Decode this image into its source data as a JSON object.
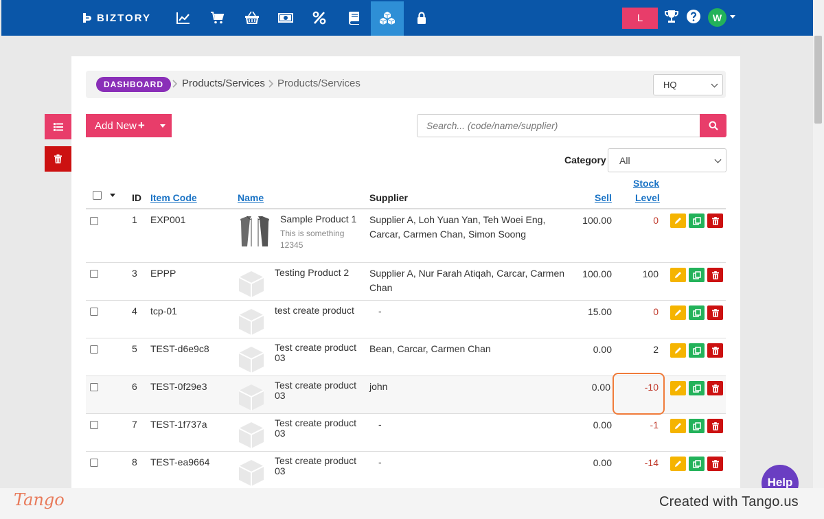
{
  "app": {
    "brand": "BIZTORY",
    "user_badge": "L",
    "avatar_initial": "W"
  },
  "nav_icons": [
    "chart-line-icon",
    "cart-icon",
    "basket-icon",
    "money-icon",
    "percent-icon",
    "book-icon",
    "cubes-icon",
    "lock-icon"
  ],
  "breadcrumb": {
    "root": "DASHBOARD",
    "items": [
      "Products/Services",
      "Products/Services"
    ]
  },
  "branch_select": {
    "value": "HQ"
  },
  "toolbar": {
    "add_new_label": "Add New",
    "search_placeholder": "Search... (code/name/supplier)"
  },
  "category": {
    "label": "Category",
    "value": "All"
  },
  "table": {
    "columns": {
      "id": "ID",
      "item_code": "Item Code",
      "name": "Name",
      "supplier": "Supplier",
      "sell": "Sell",
      "stock_1": "Stock",
      "stock_2": "Level"
    },
    "rows": [
      {
        "id": "1",
        "code": "EXP001",
        "name": "Sample Product 1",
        "desc_1": "This is something",
        "desc_2": "12345",
        "supplier_1": "Supplier A, Loh Yuan Yan, Teh Woei Eng,",
        "supplier_2": "Carcar, Carmen Chan, Simon Soong",
        "sell": "100.00",
        "stock": "0",
        "image": "shirt"
      },
      {
        "id": "3",
        "code": "EPPP",
        "name_1": "Testing Product 2",
        "supplier_1": "Supplier A, Nur Farah Atiqah, Carcar, Carmen",
        "supplier_2": "Chan",
        "sell": "100.00",
        "stock": "100",
        "image": "box"
      },
      {
        "id": "4",
        "code": "tcp-01",
        "name_1": "test create product",
        "supplier_1": "-",
        "sell": "15.00",
        "stock": "0",
        "image": "box"
      },
      {
        "id": "5",
        "code": "TEST-d6e9c8",
        "name_1": "Test create product",
        "name_2": "03",
        "supplier_1": "Bean, Carcar, Carmen Chan",
        "sell": "0.00",
        "stock": "2",
        "image": "box"
      },
      {
        "id": "6",
        "code": "TEST-0f29e3",
        "name_1": "Test create product",
        "name_2": "03",
        "supplier_1": "john",
        "sell": "0.00",
        "stock": "-10",
        "image": "box"
      },
      {
        "id": "7",
        "code": "TEST-1f737a",
        "name_1": "Test create product",
        "name_2": "03",
        "supplier_1": "-",
        "sell": "0.00",
        "stock": "-1",
        "image": "box"
      },
      {
        "id": "8",
        "code": "TEST-ea9664",
        "name_1": "Test create product",
        "name_2": "03",
        "supplier_1": "-",
        "sell": "0.00",
        "stock": "-14",
        "image": "box"
      }
    ]
  },
  "help_widget": {
    "label": "Help"
  },
  "footer": {
    "logo": "Tango",
    "credit": "Created with Tango.us"
  },
  "colors": {
    "nav_bg": "#0a56a8",
    "accent": "#e83d6a",
    "pill": "#8a2fb8",
    "negative": "#c0392b",
    "edit": "#f5b400",
    "copy": "#23b25a",
    "delete": "#cc1111"
  }
}
